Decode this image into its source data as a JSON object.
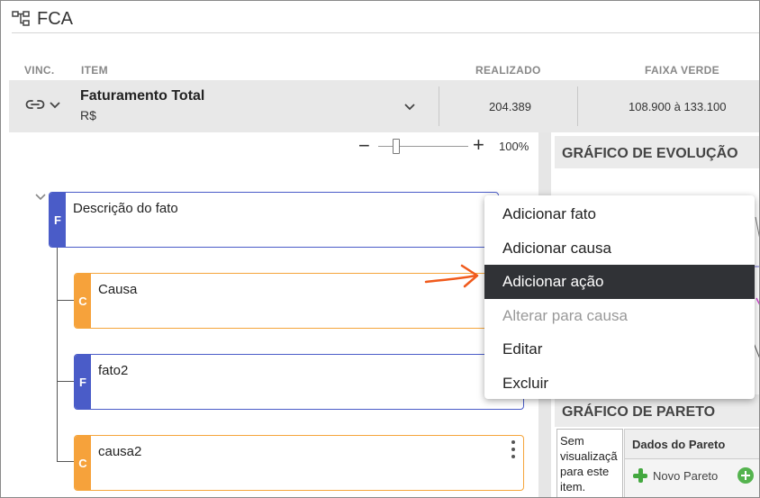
{
  "header": {
    "title": "FCA"
  },
  "columns": {
    "vinc": "VINC.",
    "item": "ITEM",
    "realizado": "REALIZADO",
    "faixa_verde": "FAIXA VERDE"
  },
  "item_row": {
    "name": "Faturamento Total",
    "unit": "R$",
    "realizado": "204.389",
    "faixa_verde": "108.900 à 133.100"
  },
  "zoom": {
    "minus": "−",
    "plus": "+",
    "level": "100%",
    "value_fraction": 0.2
  },
  "tree": {
    "nodes": [
      {
        "badge": "F",
        "label": "Descrição do fato",
        "type": "fact"
      },
      {
        "badge": "C",
        "label": "Causa",
        "type": "cause"
      },
      {
        "badge": "F",
        "label": "fato2",
        "type": "fact"
      },
      {
        "badge": "C",
        "label": "causa2",
        "type": "cause"
      }
    ]
  },
  "panels": {
    "evolucao_title": "GRÁFICO DE EVOLUÇÃO",
    "pareto_title": "GRÁFICO DE PARETO",
    "sem_visualizacao": "Sem visualizaçã para este item.",
    "dados_pareto": "Dados do Pareto",
    "novo_pareto": "Novo Pareto"
  },
  "context_menu": {
    "items": [
      {
        "label": "Adicionar fato",
        "state": "normal"
      },
      {
        "label": "Adicionar causa",
        "state": "normal"
      },
      {
        "label": "Adicionar ação",
        "state": "highlighted"
      },
      {
        "label": "Alterar para causa",
        "state": "disabled"
      },
      {
        "label": "Editar",
        "state": "normal"
      },
      {
        "label": "Excluir",
        "state": "normal"
      }
    ]
  },
  "colors": {
    "fact": "#4a5cc8",
    "cause": "#f6a23b",
    "menu_highlight": "#303236",
    "annotation_arrow": "#f05a1c",
    "green_plus": "#43a83f"
  },
  "icons": {
    "title": "org-chart-icon",
    "vinc": "link-icon",
    "row_expand": "chevron-down-icon",
    "tree_collapse": "chevron-down-icon",
    "node_menu": "more-vertical-icon",
    "novo_pareto": "plus-icon",
    "add": "plus-circle-icon",
    "annotation": "arrow-right-icon"
  }
}
